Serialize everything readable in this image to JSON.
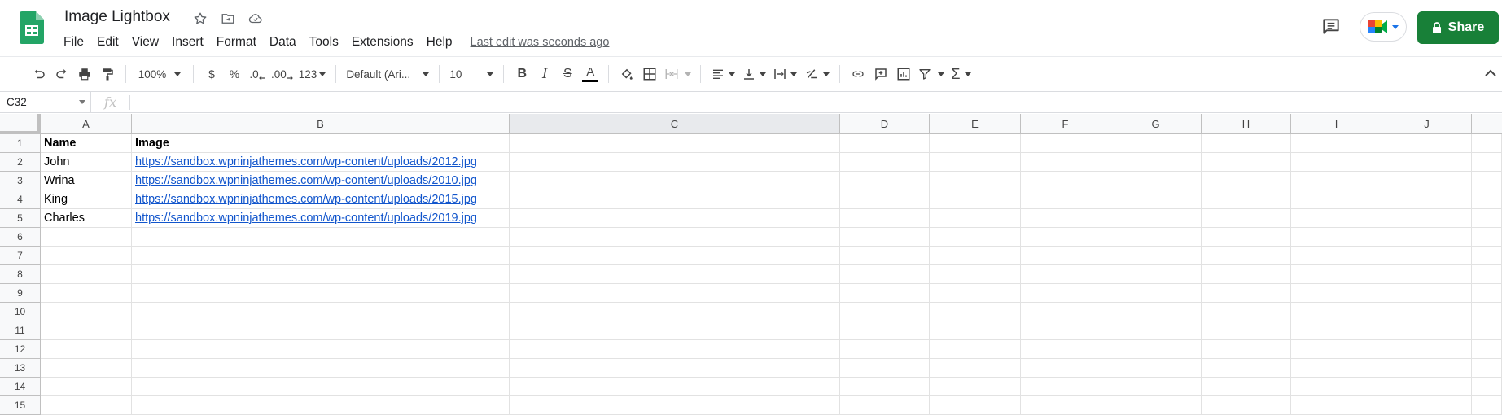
{
  "app": {
    "doc_title": "Image Lightbox",
    "menu": [
      "File",
      "Edit",
      "View",
      "Insert",
      "Format",
      "Data",
      "Tools",
      "Extensions",
      "Help"
    ],
    "last_edit": "Last edit was seconds ago",
    "share_label": "Share",
    "brand_color": "#188038"
  },
  "toolbar": {
    "zoom": "100%",
    "currency": "$",
    "percent": "%",
    "decimal_decrease": ".0",
    "decimal_increase": ".00",
    "number_format": "123",
    "font": "Default (Ari...",
    "font_size": "10"
  },
  "formula_bar": {
    "name_box": "C32",
    "fx": "fx",
    "value": ""
  },
  "sheet": {
    "columns": [
      "A",
      "B",
      "C",
      "D",
      "E",
      "F",
      "G",
      "H",
      "I",
      "J"
    ],
    "selected_column": "C",
    "rows": [
      "1",
      "2",
      "3",
      "4",
      "5",
      "6",
      "7",
      "8",
      "9",
      "10",
      "11",
      "12",
      "13",
      "14",
      "15"
    ],
    "cells": [
      [
        "Name",
        "Image"
      ],
      [
        "John",
        "https://sandbox.wpninjathemes.com/wp-content/uploads/2012.jpg"
      ],
      [
        "Wrina",
        "https://sandbox.wpninjathemes.com/wp-content/uploads/2010.jpg"
      ],
      [
        "King",
        "https://sandbox.wpninjathemes.com/wp-content/uploads/2015.jpg"
      ],
      [
        "Charles",
        "https://sandbox.wpninjathemes.com/wp-content/uploads/2019.jpg"
      ]
    ]
  }
}
